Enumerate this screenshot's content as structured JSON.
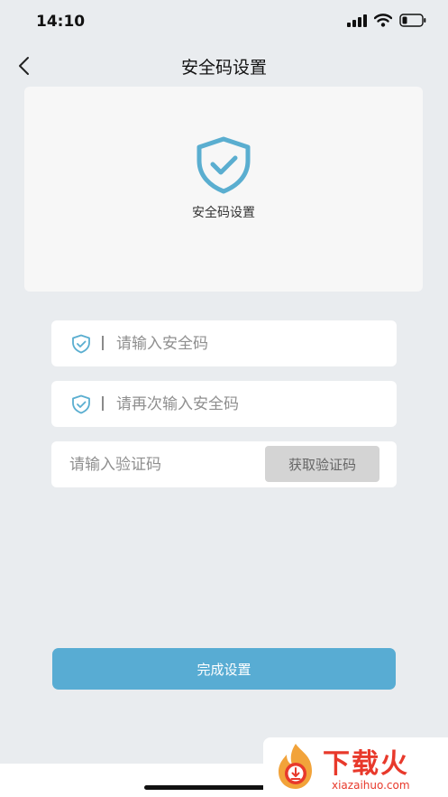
{
  "status_bar": {
    "time": "14:10"
  },
  "nav": {
    "title": "安全码设置",
    "back_icon": "chevron-left-icon"
  },
  "hero": {
    "label": "安全码设置",
    "icon": "shield-check-icon"
  },
  "form": {
    "security_code_placeholder": "请输入安全码",
    "confirm_code_placeholder": "请再次输入安全码",
    "verify_code_placeholder": "请输入验证码",
    "get_code_label": "获取验证码"
  },
  "submit": {
    "label": "完成设置"
  },
  "watermark": {
    "text": "下载火",
    "sub": "xiazaihuo.com"
  },
  "colors": {
    "accent": "#58acd3",
    "shield": "#5aaed0",
    "background": "#e9ecef",
    "watermark": "#e8392b"
  }
}
